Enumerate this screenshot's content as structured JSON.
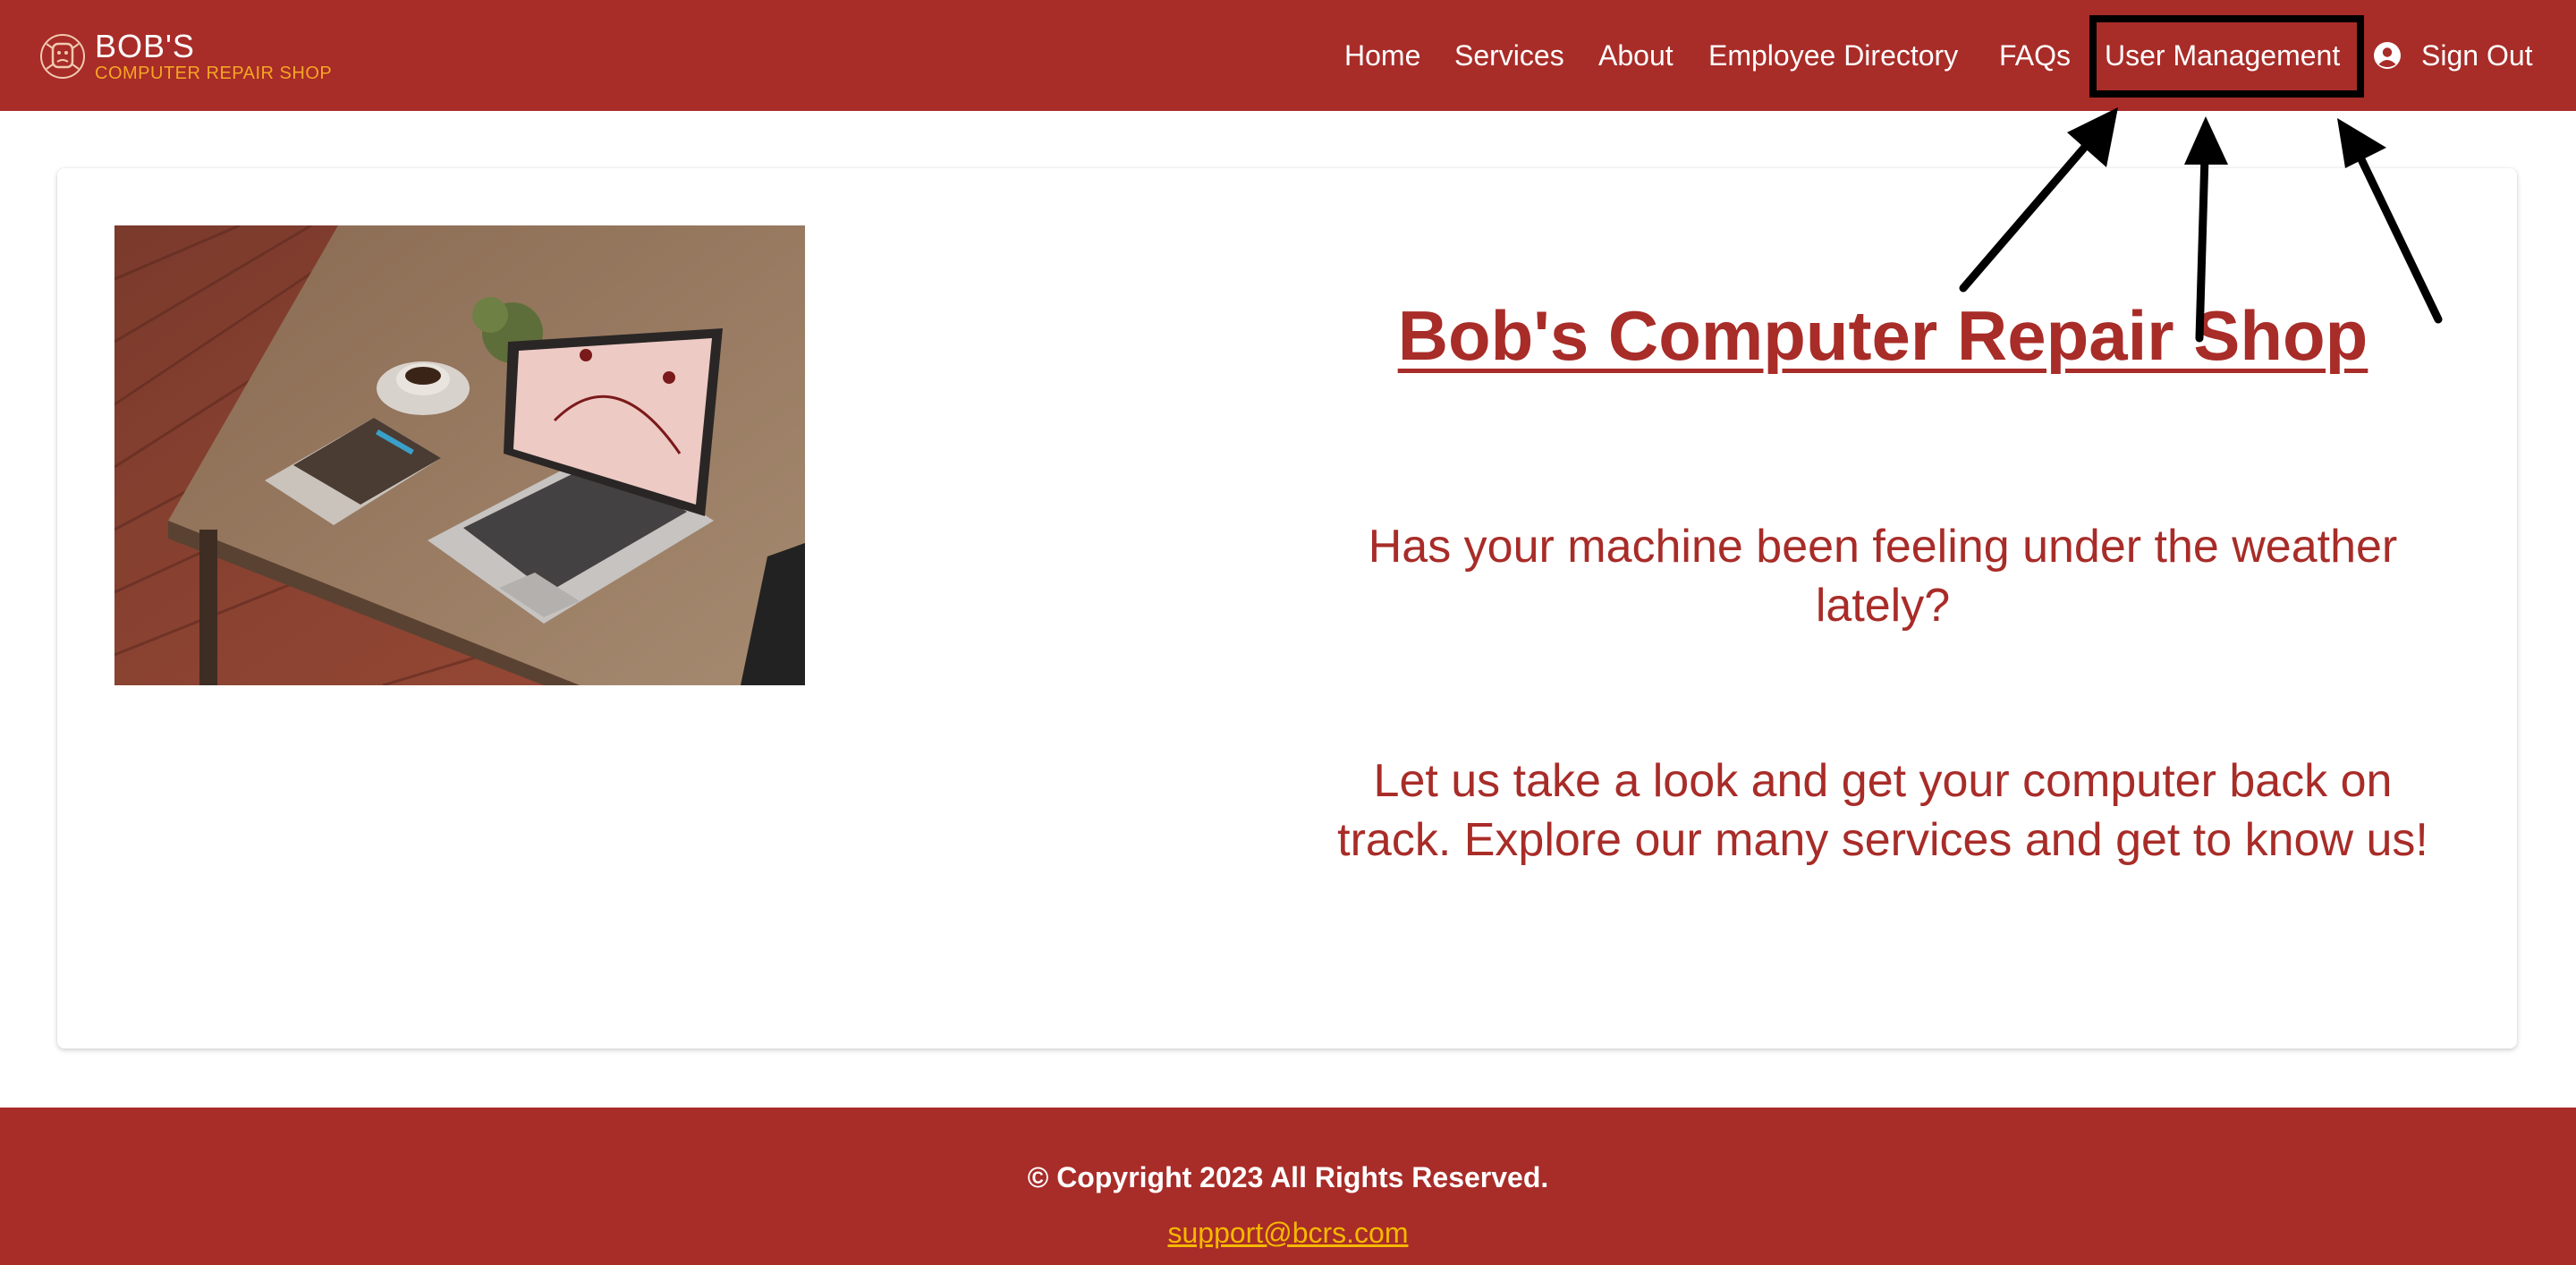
{
  "brand": {
    "name": "BOB'S",
    "subtitle": "COMPUTER REPAIR SHOP"
  },
  "nav": {
    "home": "Home",
    "services": "Services",
    "about": "About",
    "employees": "Employee Directory",
    "faqs": "FAQs",
    "users": "User Management",
    "signout": "Sign Out"
  },
  "main": {
    "title": "Bob's Computer Repair Shop",
    "tagline": "Has your machine been feeling under the weather lately?",
    "cta": "Let us take a look and get your computer back on track. Explore our many services and get to know us!"
  },
  "footer": {
    "copyright": "© Copyright 2023 All Rights Reserved.",
    "email": "support@bcrs.com"
  },
  "colors": {
    "primary": "#a82c28",
    "accent": "#f5a623",
    "text_light": "#ffffff"
  },
  "icons": {
    "logo": "computer-logo-icon",
    "user": "user-circle-icon"
  }
}
